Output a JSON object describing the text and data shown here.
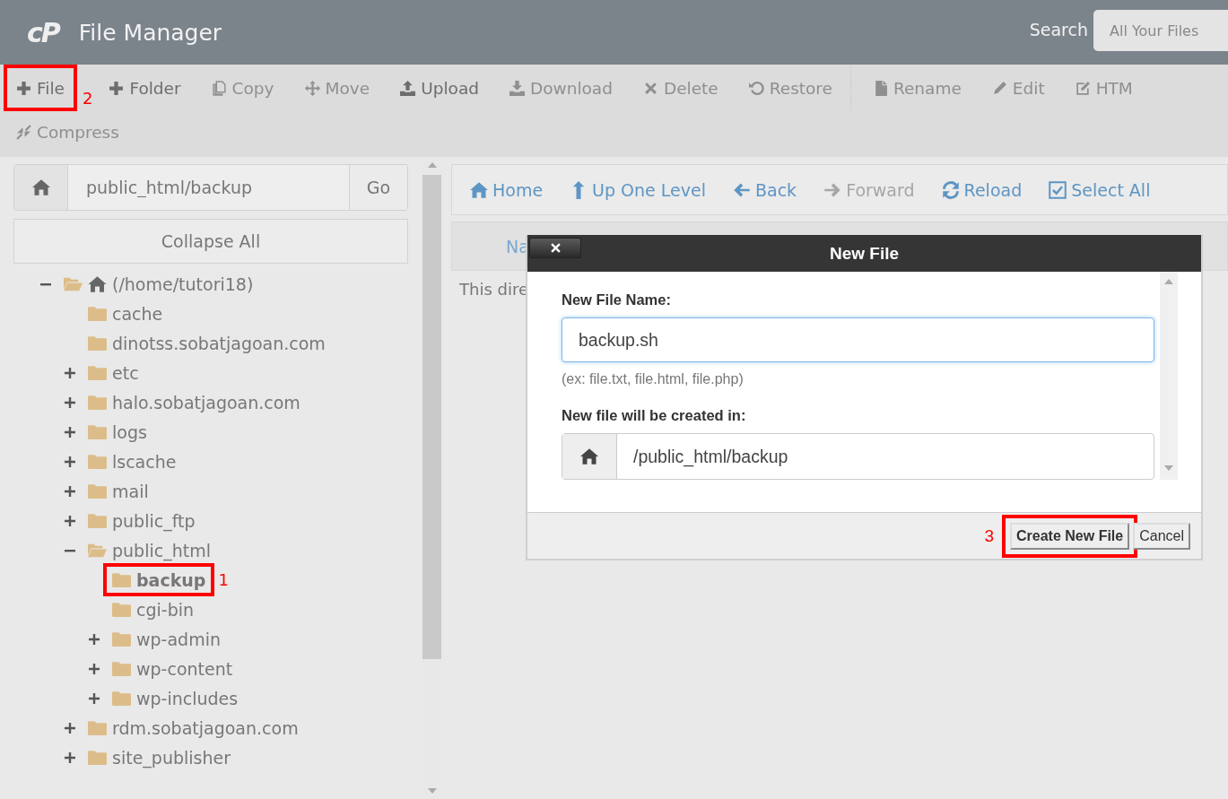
{
  "header": {
    "logo": "cP",
    "title": "File Manager",
    "search_label": "Search",
    "search_scope": "All Your Files"
  },
  "toolbar": {
    "rows": [
      [
        {
          "label": "File",
          "disabled": false,
          "marked": true,
          "callout": "2"
        },
        {
          "label": "Folder",
          "disabled": false,
          "marked": false
        },
        {
          "label": "Copy",
          "disabled": true,
          "marked": false
        },
        {
          "label": "Move",
          "disabled": true,
          "marked": false
        },
        {
          "label": "Upload",
          "disabled": false,
          "marked": false
        },
        {
          "label": "Download",
          "disabled": true,
          "marked": false
        },
        {
          "label": "Delete",
          "disabled": true,
          "marked": false
        },
        {
          "label": "Restore",
          "disabled": true,
          "marked": false
        },
        {
          "label": "Rename",
          "disabled": true,
          "marked": false
        },
        {
          "label": "Edit",
          "disabled": true,
          "marked": false
        },
        {
          "label": "HTM",
          "disabled": true,
          "marked": false
        }
      ],
      [
        {
          "label": "Compress",
          "disabled": true,
          "marked": false
        }
      ]
    ]
  },
  "sidebar": {
    "path": "public_html/backup",
    "go": "Go",
    "collapse": "Collapse All",
    "tree": [
      {
        "label": "(/home/tutori18)",
        "expandable": true,
        "expanded": true,
        "selected": false,
        "marked": false,
        "children": [
          {
            "label": "cache",
            "expandable": false,
            "expanded": false,
            "selected": false,
            "marked": false
          },
          {
            "label": "dinotss.sobatjagoan.com",
            "expandable": false,
            "expanded": false,
            "selected": false,
            "marked": false
          },
          {
            "label": "etc",
            "expandable": true,
            "expanded": false,
            "selected": false,
            "marked": false
          },
          {
            "label": "halo.sobatjagoan.com",
            "expandable": true,
            "expanded": false,
            "selected": false,
            "marked": false
          },
          {
            "label": "logs",
            "expandable": true,
            "expanded": false,
            "selected": false,
            "marked": false
          },
          {
            "label": "lscache",
            "expandable": true,
            "expanded": false,
            "selected": false,
            "marked": false
          },
          {
            "label": "mail",
            "expandable": true,
            "expanded": false,
            "selected": false,
            "marked": false
          },
          {
            "label": "public_ftp",
            "expandable": true,
            "expanded": false,
            "selected": false,
            "marked": false
          },
          {
            "label": "public_html",
            "expandable": true,
            "expanded": true,
            "selected": false,
            "marked": false,
            "children": [
              {
                "label": "backup",
                "expandable": false,
                "expanded": false,
                "selected": true,
                "marked": true,
                "callout": "1"
              },
              {
                "label": "cgi-bin",
                "expandable": false,
                "expanded": false,
                "selected": false,
                "marked": false
              },
              {
                "label": "wp-admin",
                "expandable": true,
                "expanded": false,
                "selected": false,
                "marked": false
              },
              {
                "label": "wp-content",
                "expandable": true,
                "expanded": false,
                "selected": false,
                "marked": false
              },
              {
                "label": "wp-includes",
                "expandable": true,
                "expanded": false,
                "selected": false,
                "marked": false
              }
            ]
          },
          {
            "label": "rdm.sobatjagoan.com",
            "expandable": true,
            "expanded": false,
            "selected": false,
            "marked": false
          },
          {
            "label": "site_publisher",
            "expandable": true,
            "expanded": false,
            "selected": false,
            "marked": false
          }
        ]
      }
    ]
  },
  "navigation": [
    {
      "label": "Home",
      "disabled": false
    },
    {
      "label": "Up One Level",
      "disabled": false
    },
    {
      "label": "Back",
      "disabled": false
    },
    {
      "label": "Forward",
      "disabled": true
    },
    {
      "label": "Reload",
      "disabled": false
    },
    {
      "label": "Select All",
      "disabled": false
    }
  ],
  "table": {
    "column_1": "Na",
    "message": "This dire"
  },
  "dialog": {
    "title": "New File",
    "name_label": "New File Name:",
    "name_value": "backup.sh",
    "name_hint": "(ex: file.txt, file.html, file.php)",
    "location_label": "New file will be created in:",
    "location_value": "/public_html/backup",
    "buttons": [
      {
        "label": "Create New File",
        "marked": true,
        "callout": "3"
      },
      {
        "label": "Cancel",
        "marked": false
      }
    ]
  }
}
